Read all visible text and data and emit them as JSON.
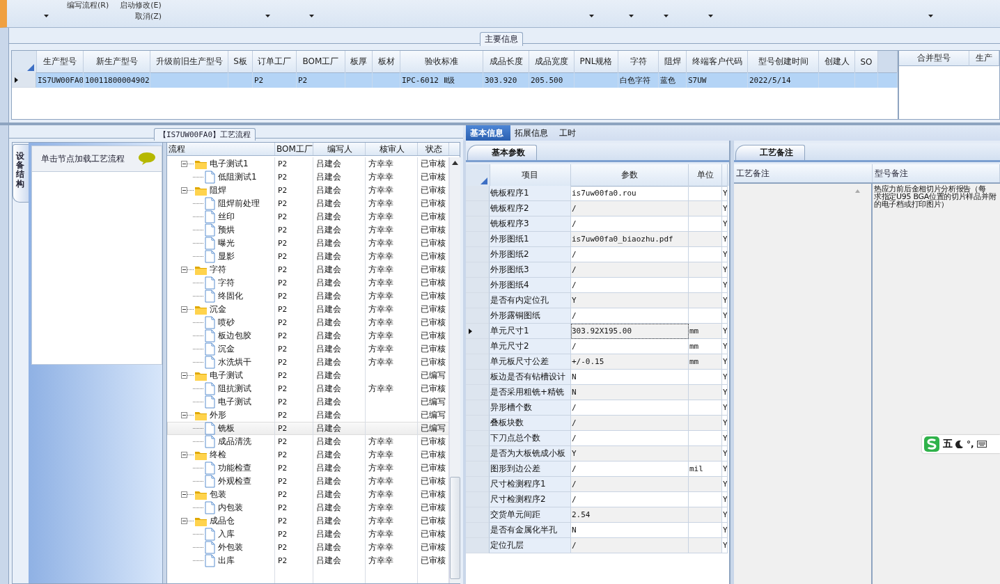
{
  "ribbon": {
    "top_row": [
      "编写流程(R)",
      "启动修改(E)"
    ],
    "bottom_row": [
      "取消(Z)"
    ]
  },
  "main_info": {
    "title": "主要信息",
    "columns": [
      "生产型号",
      "新生产型号",
      "升级前旧生产型号",
      "S板",
      "订单工厂",
      "BOM工厂",
      "板厚",
      "板材",
      "验收标准",
      "成品长度",
      "成品宽度",
      "PNL规格",
      "字符",
      "阻焊",
      "终端客户代码",
      "型号创建时间",
      "创建人",
      "SO"
    ],
    "rows": [
      {
        "selected": true,
        "cells": [
          "IS7UW00FA0",
          "10011800004902",
          "",
          "",
          "P2",
          "P2",
          "",
          "",
          "IPC-6012 Ⅱ级",
          "303.920",
          "205.500",
          "",
          "白色字符",
          "蓝色",
          "S7UW",
          "2022/5/14",
          "",
          ""
        ]
      }
    ]
  },
  "merge_table": {
    "columns": [
      "合并型号",
      "生产"
    ]
  },
  "process": {
    "title": "【IS7UW00FA0】工艺流程",
    "side_tab": "设备结构",
    "hint": "单击节点加载工艺流程",
    "tree": {
      "columns": [
        "流程",
        "BOM工厂",
        "编写人",
        "核审人",
        "状态"
      ],
      "nodes": [
        {
          "name": "电子测试1",
          "bom": "P2",
          "writer": "吕建会",
          "reviewer": "方幸幸",
          "status": "已审核",
          "expanded": true,
          "selected": false,
          "children": [
            {
              "name": "低阻测试1",
              "bom": "P2",
              "writer": "吕建会",
              "reviewer": "方幸幸",
              "status": "已审核",
              "selected": false
            }
          ]
        },
        {
          "name": "阻焊",
          "bom": "P2",
          "writer": "吕建会",
          "reviewer": "方幸幸",
          "status": "已审核",
          "expanded": true,
          "selected": false,
          "children": [
            {
              "name": "阻焊前处理",
              "bom": "P2",
              "writer": "吕建会",
              "reviewer": "方幸幸",
              "status": "已审核",
              "selected": false
            },
            {
              "name": "丝印",
              "bom": "P2",
              "writer": "吕建会",
              "reviewer": "方幸幸",
              "status": "已审核",
              "selected": false
            },
            {
              "name": "预烘",
              "bom": "P2",
              "writer": "吕建会",
              "reviewer": "方幸幸",
              "status": "已审核",
              "selected": false
            },
            {
              "name": "曝光",
              "bom": "P2",
              "writer": "吕建会",
              "reviewer": "方幸幸",
              "status": "已审核",
              "selected": false
            },
            {
              "name": "显影",
              "bom": "P2",
              "writer": "吕建会",
              "reviewer": "方幸幸",
              "status": "已审核",
              "selected": false
            }
          ]
        },
        {
          "name": "字符",
          "bom": "P2",
          "writer": "吕建会",
          "reviewer": "方幸幸",
          "status": "已审核",
          "expanded": true,
          "selected": false,
          "children": [
            {
              "name": "字符",
              "bom": "P2",
              "writer": "吕建会",
              "reviewer": "方幸幸",
              "status": "已审核",
              "selected": false
            },
            {
              "name": "终固化",
              "bom": "P2",
              "writer": "吕建会",
              "reviewer": "方幸幸",
              "status": "已审核",
              "selected": false
            }
          ]
        },
        {
          "name": "沉金",
          "bom": "P2",
          "writer": "吕建会",
          "reviewer": "方幸幸",
          "status": "已审核",
          "expanded": true,
          "selected": false,
          "children": [
            {
              "name": "喷砂",
              "bom": "P2",
              "writer": "吕建会",
              "reviewer": "方幸幸",
              "status": "已审核",
              "selected": false
            },
            {
              "name": "板边包胶",
              "bom": "P2",
              "writer": "吕建会",
              "reviewer": "方幸幸",
              "status": "已审核",
              "selected": false
            },
            {
              "name": "沉金",
              "bom": "P2",
              "writer": "吕建会",
              "reviewer": "方幸幸",
              "status": "已审核",
              "selected": false
            },
            {
              "name": "水洗烘干",
              "bom": "P2",
              "writer": "吕建会",
              "reviewer": "方幸幸",
              "status": "已审核",
              "selected": false
            }
          ]
        },
        {
          "name": "电子测试",
          "bom": "P2",
          "writer": "吕建会",
          "status": "已编写",
          "expanded": true,
          "selected": false,
          "children": [
            {
              "name": "阻抗测试",
              "bom": "P2",
              "writer": "吕建会",
              "reviewer": "方幸幸",
              "status": "已审核",
              "selected": false
            },
            {
              "name": "电子测试",
              "bom": "P2",
              "writer": "吕建会",
              "status": "已编写",
              "selected": false
            }
          ]
        },
        {
          "name": "外形",
          "bom": "P2",
          "writer": "吕建会",
          "status": "已编写",
          "expanded": true,
          "selected": false,
          "children": [
            {
              "name": "铣板",
              "bom": "P2",
              "writer": "吕建会",
              "status": "已编写",
              "selected": true
            },
            {
              "name": "成品清洗",
              "bom": "P2",
              "writer": "吕建会",
              "reviewer": "方幸幸",
              "status": "已审核",
              "selected": false
            }
          ]
        },
        {
          "name": "终检",
          "bom": "P2",
          "writer": "吕建会",
          "reviewer": "方幸幸",
          "status": "已审核",
          "expanded": true,
          "selected": false,
          "children": [
            {
              "name": "功能检查",
              "bom": "P2",
              "writer": "吕建会",
              "reviewer": "方幸幸",
              "status": "已审核",
              "selected": false
            },
            {
              "name": "外观检查",
              "bom": "P2",
              "writer": "吕建会",
              "reviewer": "方幸幸",
              "status": "已审核",
              "selected": false
            }
          ]
        },
        {
          "name": "包装",
          "bom": "P2",
          "writer": "吕建会",
          "reviewer": "方幸幸",
          "status": "已审核",
          "expanded": true,
          "selected": false,
          "children": [
            {
              "name": "内包装",
              "bom": "P2",
              "writer": "吕建会",
              "reviewer": "方幸幸",
              "status": "已审核",
              "selected": false
            }
          ]
        },
        {
          "name": "成品仓",
          "bom": "P2",
          "writer": "吕建会",
          "reviewer": "方幸幸",
          "status": "已审核",
          "expanded": true,
          "selected": false,
          "children": [
            {
              "name": "入库",
              "bom": "P2",
              "writer": "吕建会",
              "reviewer": "方幸幸",
              "status": "已审核",
              "selected": false
            },
            {
              "name": "外包装",
              "bom": "P2",
              "writer": "吕建会",
              "reviewer": "方幸幸",
              "status": "已审核",
              "selected": false
            },
            {
              "name": "出库",
              "bom": "P2",
              "writer": "吕建会",
              "reviewer": "方幸幸",
              "status": "已审核",
              "selected": false
            }
          ]
        }
      ]
    }
  },
  "details": {
    "tabs": [
      {
        "label": "基本信息",
        "selected": true
      },
      {
        "label": "拓展信息",
        "selected": false
      },
      {
        "label": "工时",
        "selected": false
      }
    ],
    "subtab": "基本参数",
    "columns": [
      "项目",
      "参数",
      "单位"
    ],
    "rows": [
      {
        "item": "铣板程序1",
        "value": "is7uw00fa0.rou",
        "unit": "",
        "column_4": "Y",
        "selected": false
      },
      {
        "item": "铣板程序2",
        "value": "/",
        "unit": "",
        "column_4": "Y",
        "selected": false
      },
      {
        "item": "铣板程序3",
        "value": "/",
        "unit": "",
        "column_4": "Y",
        "selected": false
      },
      {
        "item": "外形图纸1",
        "value": "is7uw00fa0_biaozhu.pdf",
        "unit": "",
        "column_4": "Y",
        "selected": false
      },
      {
        "item": "外形图纸2",
        "value": "/",
        "unit": "",
        "column_4": "Y",
        "selected": false
      },
      {
        "item": "外形图纸3",
        "value": "/",
        "unit": "",
        "column_4": "Y",
        "selected": false
      },
      {
        "item": "外形图纸4",
        "value": "/",
        "unit": "",
        "column_4": "Y",
        "selected": false
      },
      {
        "item": "是否有内定位孔",
        "value": "Y",
        "unit": "",
        "column_4": "Y",
        "selected": false
      },
      {
        "item": "外形露铜图纸",
        "value": "/",
        "unit": "",
        "column_4": "Y",
        "selected": false
      },
      {
        "item": "单元尺寸1",
        "value": "303.92X195.00",
        "unit": "mm",
        "column_4": "Y",
        "selected": true
      },
      {
        "item": "单元尺寸2",
        "value": "/",
        "unit": "mm",
        "column_4": "Y",
        "selected": false
      },
      {
        "item": "单元板尺寸公差",
        "value": "+/-0.15",
        "unit": "mm",
        "column_4": "Y",
        "selected": false
      },
      {
        "item": "板边是否有钻槽设计",
        "value": "N",
        "unit": "",
        "column_4": "Y",
        "selected": false
      },
      {
        "item": "是否采用粗铣+精铣",
        "value": "N",
        "unit": "",
        "column_4": "Y",
        "selected": false
      },
      {
        "item": "异形槽个数",
        "value": "/",
        "unit": "",
        "column_4": "Y",
        "selected": false
      },
      {
        "item": "叠板块数",
        "value": "/",
        "unit": "",
        "column_4": "Y",
        "selected": false
      },
      {
        "item": "下刀点总个数",
        "value": "/",
        "unit": "",
        "column_4": "Y",
        "selected": false
      },
      {
        "item": "是否为大板铣成小板",
        "value": "Y",
        "unit": "",
        "column_4": "Y",
        "selected": false
      },
      {
        "item": "图形到边公差",
        "value": "/",
        "unit": "mil",
        "column_4": "Y",
        "selected": false
      },
      {
        "item": "尺寸检测程序1",
        "value": "/",
        "unit": "",
        "column_4": "Y",
        "selected": false
      },
      {
        "item": "尺寸检测程序2",
        "value": "/",
        "unit": "",
        "column_4": "Y",
        "selected": false
      },
      {
        "item": "交货单元间距",
        "value": "2.54",
        "unit": "",
        "column_4": "Y",
        "selected": false
      },
      {
        "item": "是否有金属化半孔",
        "value": "N",
        "unit": "",
        "column_4": "Y",
        "selected": false
      },
      {
        "item": "定位孔层",
        "value": "/",
        "unit": "",
        "column_4": "Y",
        "selected": false
      }
    ]
  },
  "notes": {
    "tab": "工艺备注",
    "columns": [
      "工艺备注",
      "型号备注"
    ],
    "model_note": [
      "热应力前后金相切片分析报告（每",
      "求指定U95 BGA位置的切片样品并附",
      "的电子档或打印图片）"
    ]
  },
  "ime_bar": {
    "mode": "五",
    "punctuation": "°,"
  }
}
